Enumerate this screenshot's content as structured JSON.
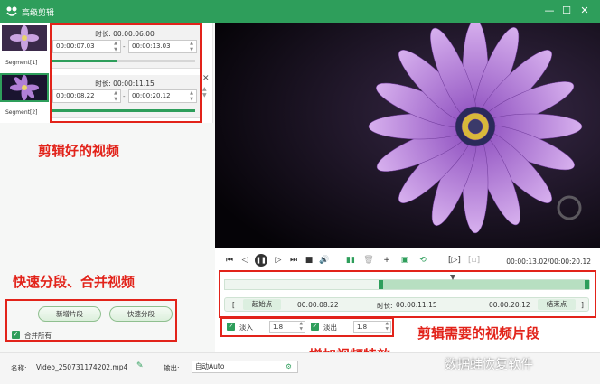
{
  "window": {
    "title": "高级剪辑",
    "minimize": "—",
    "maximize": "☐",
    "close": "✕"
  },
  "segments": [
    {
      "label": "Segment[1]",
      "duration_label": "时长:",
      "duration": "00:00:06.00",
      "start": "00:00:07.03",
      "end": "00:00:13.03",
      "progress": 0.45
    },
    {
      "label": "Segment[2]",
      "duration_label": "时长:",
      "duration": "00:00:11.15",
      "start": "00:00:08.22",
      "end": "00:00:20.12",
      "progress": 1.0
    }
  ],
  "separator": "-",
  "annotations": {
    "segments": "剪辑好的视频",
    "quick": "快速分段、合并视频",
    "clip": "剪辑需要的视频片段",
    "effects": "增加视频特效"
  },
  "left_actions": {
    "new_segment": "新增片段",
    "quick_split": "快速分段",
    "merge_all": "合并所有"
  },
  "player": {
    "time": "00:00:13.02/00:00:20.12"
  },
  "cut": {
    "start_bracket": "[",
    "start_label": "起始点",
    "start_value": "00:00:08.22",
    "duration_label": "时长:",
    "duration_value": "00:00:11.15",
    "end_value": "00:00:20.12",
    "end_label": "结束点",
    "end_bracket": "]"
  },
  "effects": {
    "fade_in_label": "淡入",
    "fade_in_value": "1.8",
    "fade_out_label": "淡出",
    "fade_out_value": "1.8"
  },
  "bottom": {
    "name_label": "名称:",
    "name_value": "Video_250731174202.mp4",
    "output_label": "输出:",
    "output_value": "自动Auto"
  },
  "watermark": "数据蛙恢复软件",
  "icons": [
    "frog-logo-icon",
    "minimize-icon",
    "maximize-icon",
    "close-icon",
    "play-pause-icon",
    "volume-icon",
    "edit-pencil-icon",
    "gear-icon"
  ],
  "colors": {
    "brand_green": "#2e9e5b",
    "annotation_red": "#e2231a",
    "timeline_range": "#b7dfc1"
  }
}
